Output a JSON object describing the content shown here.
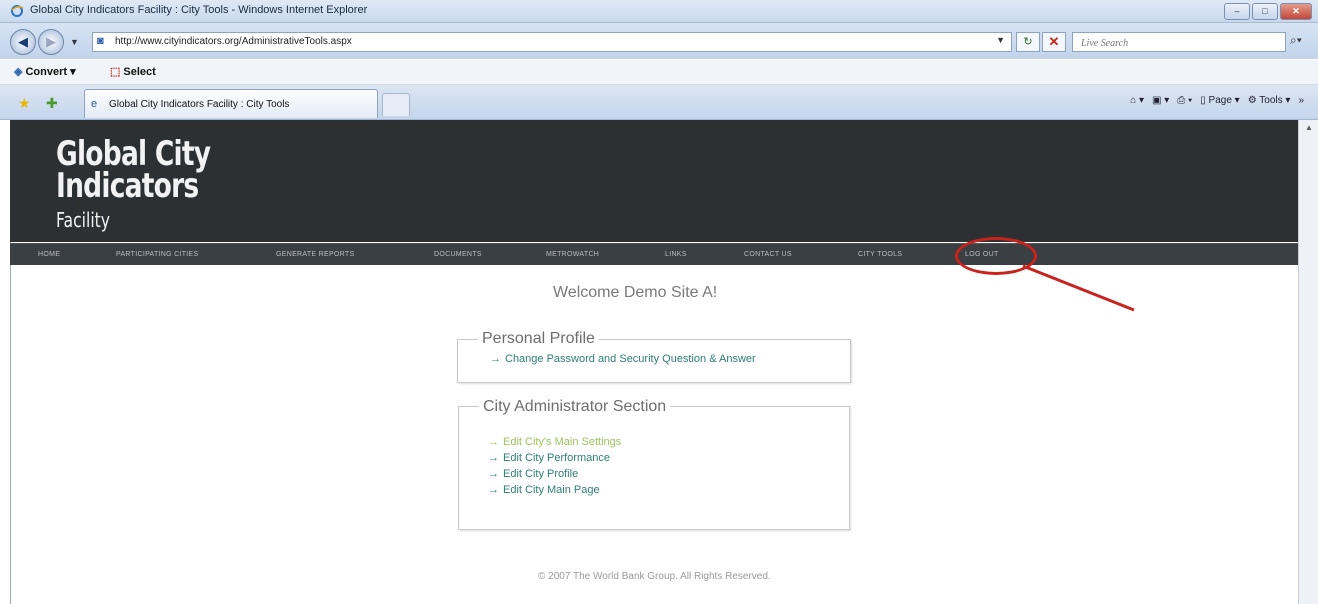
{
  "window": {
    "title": "Global City Indicators Facility : City Tools - Windows Internet Explorer",
    "controls": [
      "–",
      "□",
      "✕"
    ]
  },
  "address_bar": {
    "url": "http://www.cityindicators.org/AdministrativeTools.aspx",
    "search_placeholder": "Live Search"
  },
  "command_bar": {
    "convert_label": "Convert",
    "select_label": "Select"
  },
  "tab_bar": {
    "tab_title": "Global City Indicators Facility : City Tools",
    "page_label": "Page",
    "tools_label": "Tools"
  },
  "site": {
    "logo": {
      "line1": "Global City",
      "line2": "Indicators",
      "line3": "Facility"
    },
    "nav": [
      {
        "label": "HOME"
      },
      {
        "label": "PARTICIPATING CITIES"
      },
      {
        "label": "GENERATE REPORTS"
      },
      {
        "label": "DOCUMENTS"
      },
      {
        "label": "METROWATCH"
      },
      {
        "label": "LINKS"
      },
      {
        "label": "CONTACT US"
      },
      {
        "label": "CITY TOOLS"
      },
      {
        "label": "LOG OUT"
      }
    ],
    "welcome": "Welcome Demo Site A!",
    "personal_profile": {
      "legend": "Personal Profile",
      "links": [
        {
          "label": "Change Password and Security Question & Answer"
        }
      ]
    },
    "city_admin": {
      "legend": "City Administrator Section",
      "links": [
        {
          "label": "Edit City's Main Settings"
        },
        {
          "label": "Edit City Performance"
        },
        {
          "label": "Edit City Profile"
        },
        {
          "label": "Edit City Main Page"
        }
      ]
    },
    "footer": "© 2007 The World Bank Group. All Rights Reserved."
  },
  "annotation": {
    "color": "#c8231d"
  },
  "icons": {
    "back": "back-arrow-icon",
    "forward": "forward-arrow-icon",
    "refresh": "refresh-icon",
    "stop": "stop-icon",
    "search": "search-icon",
    "favorites": "star-icon",
    "add_favorites": "add-favorites-icon"
  }
}
